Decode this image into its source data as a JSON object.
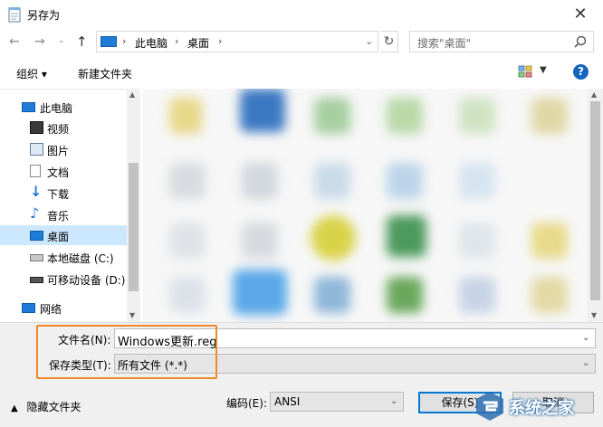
{
  "window": {
    "title": "另存为"
  },
  "address": {
    "crumbs": [
      "此电脑",
      "桌面"
    ]
  },
  "search": {
    "placeholder": "搜索\"桌面\""
  },
  "toolbar": {
    "organize": "组织 ▾",
    "new_folder": "新建文件夹"
  },
  "nav": {
    "items": [
      {
        "label": "此电脑",
        "icon": "pc-icon"
      },
      {
        "label": "视频",
        "icon": "video-icon"
      },
      {
        "label": "图片",
        "icon": "picture-icon"
      },
      {
        "label": "文档",
        "icon": "document-icon"
      },
      {
        "label": "下载",
        "icon": "download-icon"
      },
      {
        "label": "音乐",
        "icon": "music-icon"
      },
      {
        "label": "桌面",
        "icon": "desktop-icon",
        "selected": true
      },
      {
        "label": "本地磁盘 (C:)",
        "icon": "drive-icon"
      },
      {
        "label": "可移动设备 (D:)",
        "icon": "removable-drive-icon"
      },
      {
        "label": "网络",
        "icon": "network-icon"
      }
    ]
  },
  "form": {
    "filename_label": "文件名(N):",
    "filename_value": "Windows更新.reg",
    "type_label": "保存类型(T):",
    "type_value": "所有文件  (*.*)",
    "hide_folders": "隐藏文件夹",
    "encoding_label": "编码(E):",
    "encoding_value": "ANSI",
    "save": "保存(S)",
    "cancel": "取消"
  },
  "watermark": {
    "text": "系统之家"
  },
  "colors": {
    "accent": "#0078d7",
    "highlight": "#f08a24",
    "selection": "#cce8ff"
  }
}
